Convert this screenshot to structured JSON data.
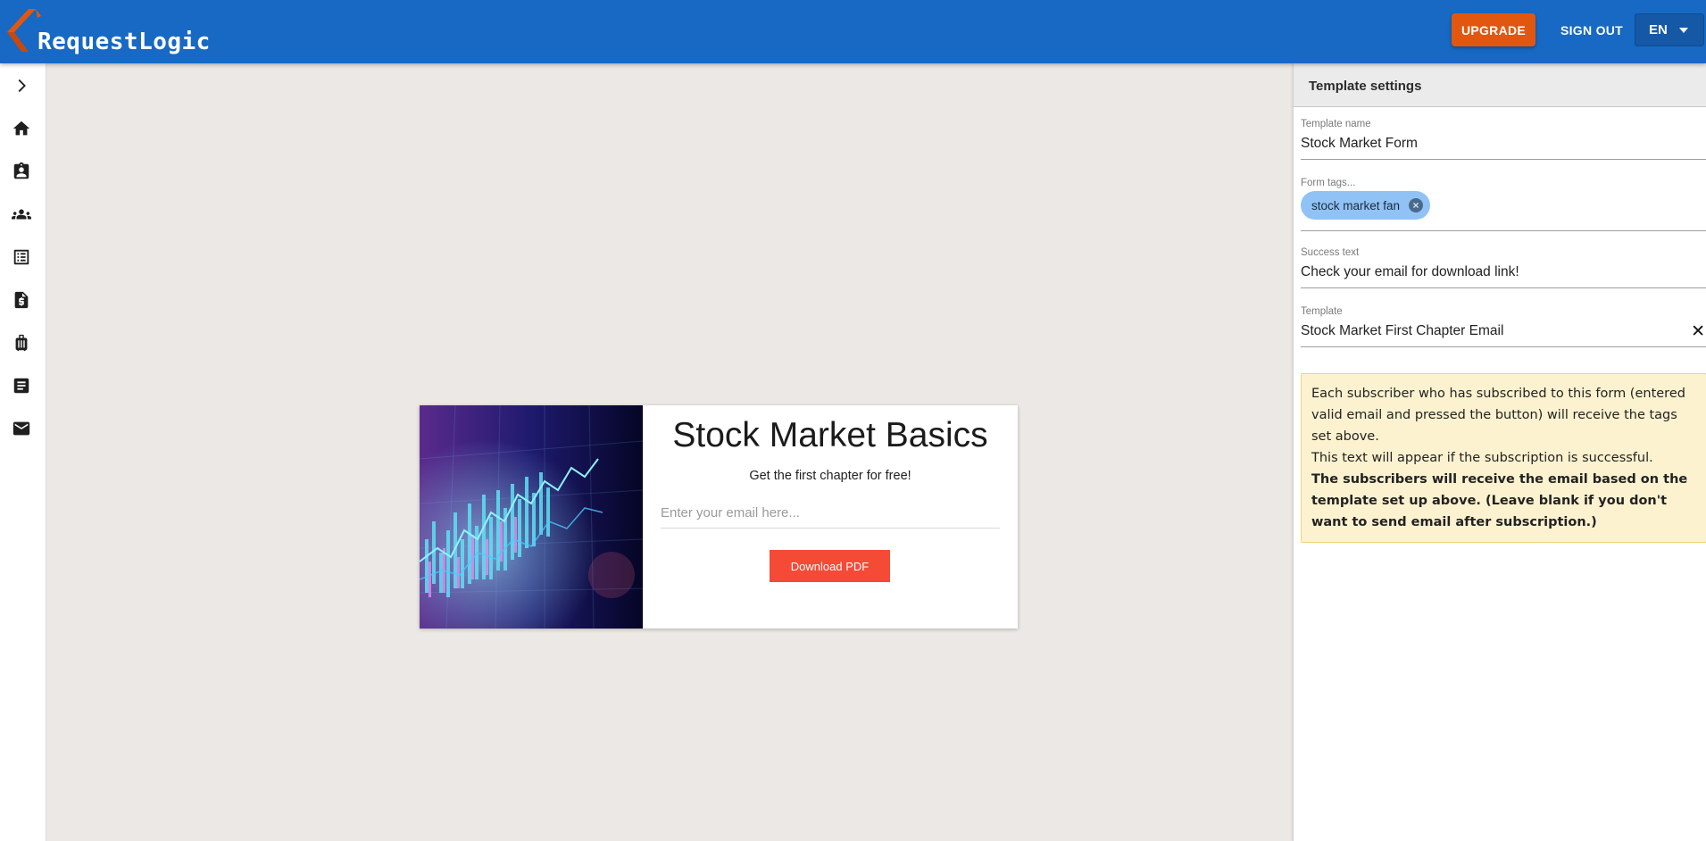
{
  "header": {
    "logo_text": "RequestLogic",
    "upgrade_label": "UPGRADE",
    "signout_label": "SIGN OUT",
    "language": "EN"
  },
  "sidebar": {
    "items": [
      {
        "icon": "chevron-right-icon"
      },
      {
        "icon": "home-icon"
      },
      {
        "icon": "contact-card-icon"
      },
      {
        "icon": "people-icon"
      },
      {
        "icon": "list-icon"
      },
      {
        "icon": "invoice-icon"
      },
      {
        "icon": "luggage-icon"
      },
      {
        "icon": "document-icon"
      },
      {
        "icon": "mail-icon"
      }
    ]
  },
  "form_preview": {
    "title": "Stock Market Basics",
    "subtitle": "Get the first chapter for free!",
    "email_placeholder": "Enter your email here...",
    "button_label": "Download PDF"
  },
  "panel": {
    "title": "Template settings",
    "template_name": {
      "label": "Template name",
      "value": "Stock Market Form"
    },
    "form_tags": {
      "label": "Form tags...",
      "tags": [
        "stock market fan"
      ]
    },
    "success_text": {
      "label": "Success text",
      "value": "Check your email for download link!"
    },
    "template": {
      "label": "Template",
      "value": "Stock Market First Chapter Email"
    },
    "info": {
      "line1": "Each subscriber who has subscribed to this form (entered valid email and pressed the button) will receive the tags set above.",
      "line2": "This text will appear if the subscription is successful.",
      "line3": "The subscribers will receive the email based on the template set up above. (Leave blank if you don't want to send email after subscription.)"
    }
  },
  "colors": {
    "topbar": "#1769c4",
    "upgrade": "#e2570f",
    "form_button": "#f44a36",
    "chip": "#90c2f6",
    "info_bg": "#fdf2d0"
  }
}
